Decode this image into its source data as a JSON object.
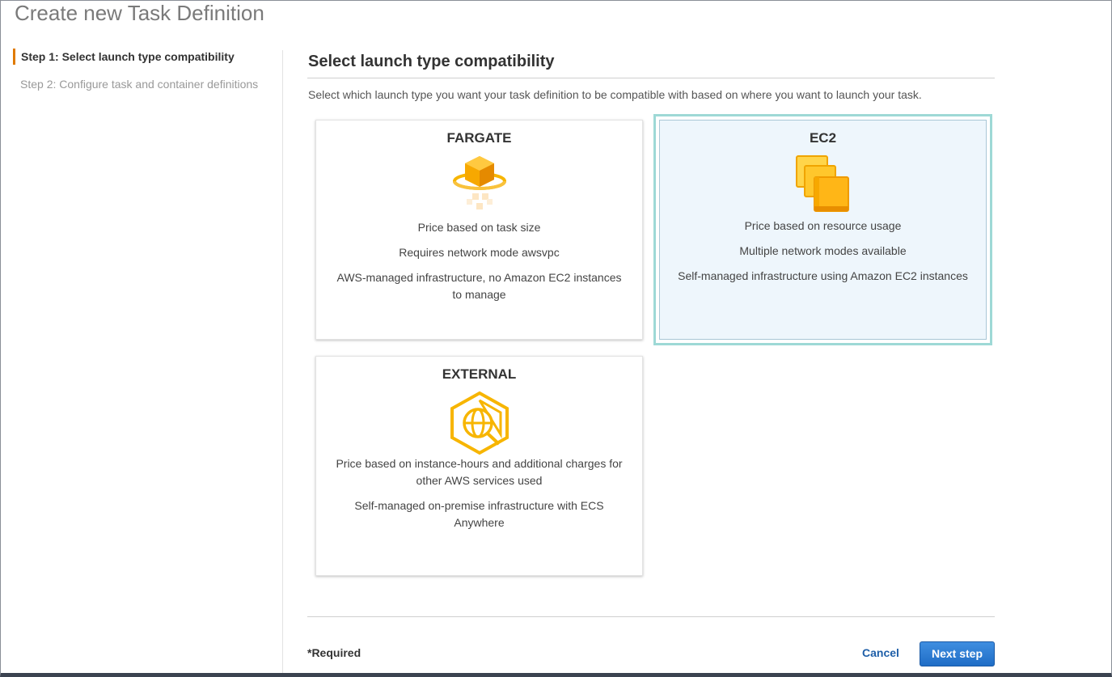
{
  "page": {
    "title": "Create new Task Definition"
  },
  "sidebar": {
    "steps": [
      {
        "label": "Step 1: Select launch type compatibility"
      },
      {
        "label": "Step 2: Configure task and container definitions"
      }
    ]
  },
  "main": {
    "section_title": "Select launch type compatibility",
    "intro": "Select which launch type you want your task definition to be compatible with based on where you want to launch your task.",
    "cards": [
      {
        "title": "FARGATE",
        "icon": "fargate-icon",
        "lines": [
          "Price based on task size",
          "Requires network mode awsvpc",
          "AWS-managed infrastructure, no Amazon EC2 instances to manage"
        ]
      },
      {
        "title": "EC2",
        "icon": "ec2-instances-icon",
        "selected": true,
        "lines": [
          "Price based on resource usage",
          "Multiple network modes available",
          "Self-managed infrastructure using Amazon EC2 instances"
        ]
      },
      {
        "title": "EXTERNAL",
        "icon": "ecs-anywhere-icon",
        "lines": [
          "Price based on instance-hours and additional charges for other AWS services used",
          "Self-managed on-premise infrastructure with ECS Anywhere"
        ]
      }
    ]
  },
  "footer": {
    "required": "*Required",
    "cancel": "Cancel",
    "next": "Next step"
  },
  "colors": {
    "accent_orange": "#e07b00",
    "link_blue": "#1f5fa8",
    "button_blue": "#2a7ad5",
    "selected_outline": "#9ed9d6",
    "selected_bg": "#eef6fc"
  }
}
